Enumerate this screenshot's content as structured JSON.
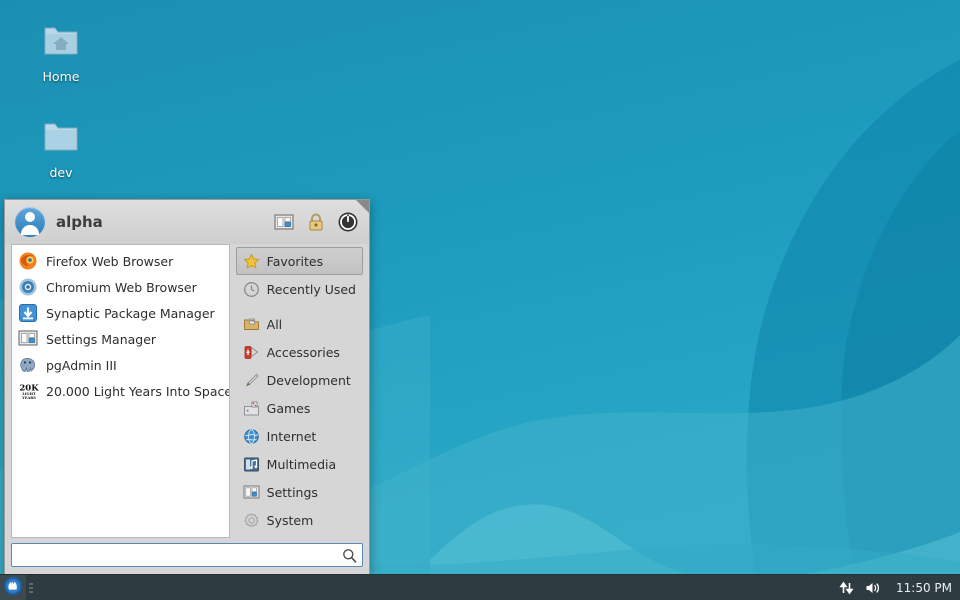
{
  "desktop": {
    "wallpaper_colors": {
      "base_top": "#1a92b4",
      "base_bottom": "#2ba8c6",
      "wave_light": "#43b4cd",
      "wave_lighter": "#5cc3d6",
      "wave_dark": "#0e86aa"
    },
    "icons": [
      {
        "name": "Home",
        "icon": "home-folder-icon"
      },
      {
        "name": "dev",
        "icon": "folder-icon"
      }
    ]
  },
  "menu": {
    "username": "alpha",
    "header_buttons": [
      {
        "label": "All Settings",
        "icon": "settings-manager-icon"
      },
      {
        "label": "Lock Screen",
        "icon": "lock-icon"
      },
      {
        "label": "Log Out",
        "icon": "power-icon"
      }
    ],
    "favorites": [
      {
        "label": "Firefox Web Browser",
        "icon": "firefox-icon"
      },
      {
        "label": "Chromium Web Browser",
        "icon": "chromium-icon"
      },
      {
        "label": "Synaptic Package Manager",
        "icon": "synaptic-icon"
      },
      {
        "label": "Settings Manager",
        "icon": "settings-manager-icon"
      },
      {
        "label": "pgAdmin III",
        "icon": "pgadmin-icon"
      },
      {
        "label": "20.000 Light Years Into Space",
        "icon": "20k-light-years-icon"
      }
    ],
    "categories": [
      {
        "label": "Favorites",
        "icon": "star-icon",
        "selected": true
      },
      {
        "label": "Recently Used",
        "icon": "clock-icon",
        "selected": false
      },
      {
        "label": "All",
        "icon": "applications-other-icon",
        "selected": false
      },
      {
        "label": "Accessories",
        "icon": "accessories-icon",
        "selected": false
      },
      {
        "label": "Development",
        "icon": "development-icon",
        "selected": false
      },
      {
        "label": "Games",
        "icon": "games-icon",
        "selected": false
      },
      {
        "label": "Internet",
        "icon": "internet-globe-icon",
        "selected": false
      },
      {
        "label": "Multimedia",
        "icon": "multimedia-icon",
        "selected": false
      },
      {
        "label": "Settings",
        "icon": "settings-icon",
        "selected": false
      },
      {
        "label": "System",
        "icon": "system-gear-icon",
        "selected": false
      }
    ],
    "search": {
      "value": "",
      "placeholder": ""
    }
  },
  "panel": {
    "launcher": {
      "label": "Applications",
      "icon": "xfce-mouse-icon"
    },
    "tray": [
      {
        "label": "Network",
        "icon": "network-updown-icon"
      },
      {
        "label": "Volume",
        "icon": "speaker-icon"
      }
    ],
    "clock": "11:50 PM"
  }
}
